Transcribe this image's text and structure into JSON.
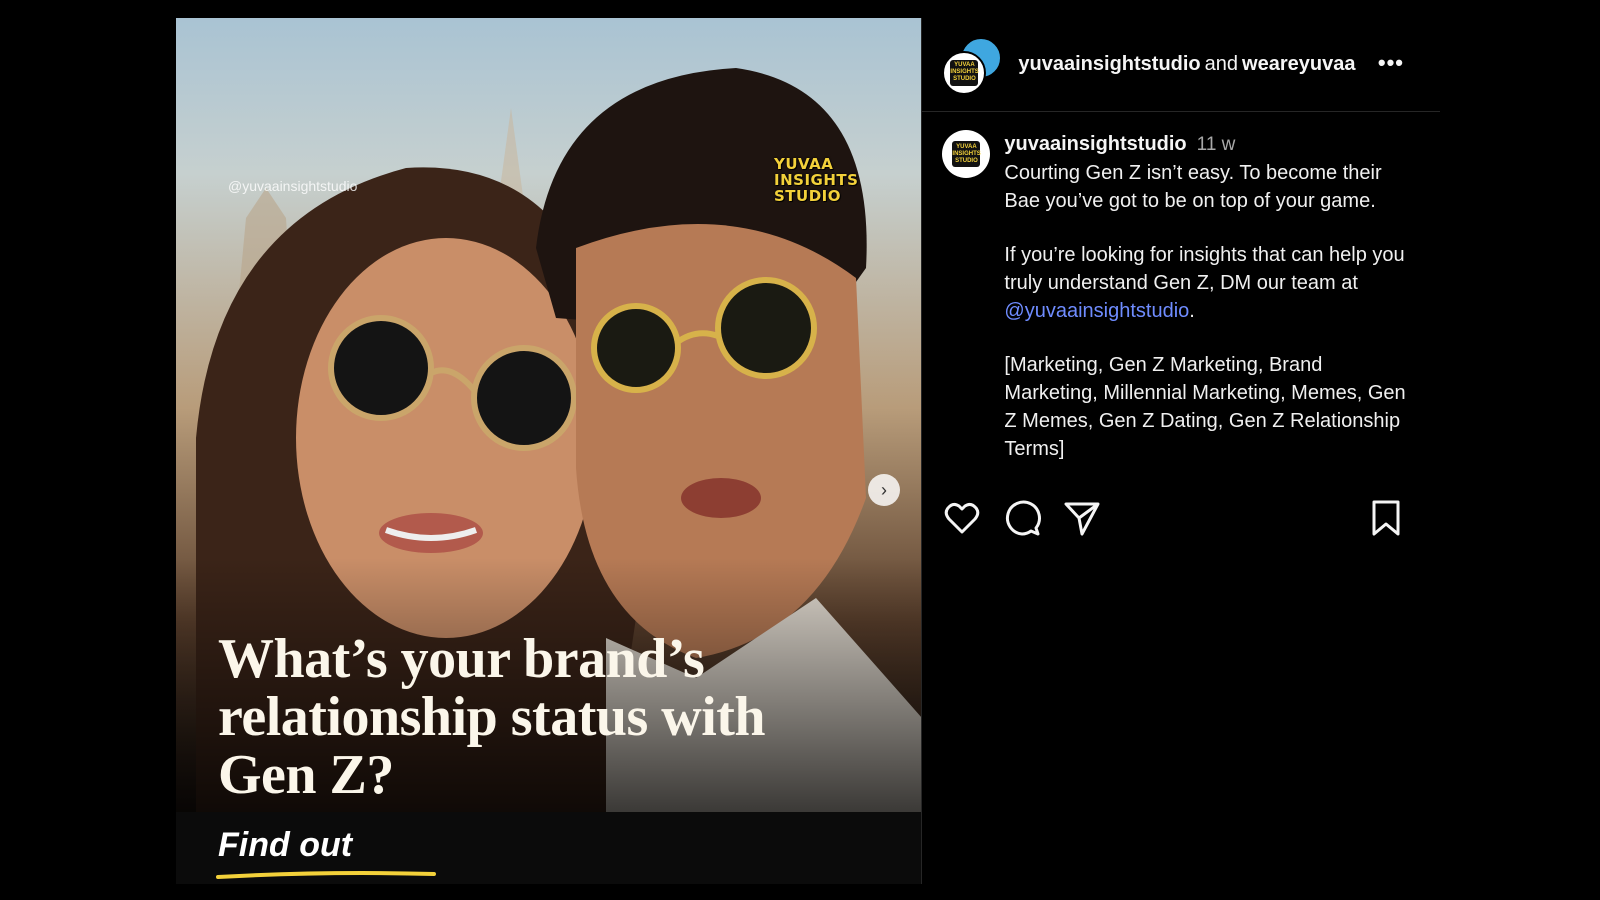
{
  "media": {
    "watermark": "@yuvaainsightstudio",
    "logo_lines": [
      "YUVAA",
      "INSIGHTS",
      "STUDIO"
    ],
    "headline_lines": [
      "What’s your brand’s",
      "relationship status with",
      "Gen Z?"
    ],
    "cta": "Find out",
    "next_icon": "chevron-right-icon",
    "accent_color": "#f3d13a"
  },
  "header": {
    "user1": "yuvaainsightstudio",
    "conj": "and",
    "user2": "weareyuvaa",
    "more_icon": "ellipsis-icon",
    "more_glyph": "•••"
  },
  "caption": {
    "username": "yuvaainsightstudio",
    "time": "11 w",
    "p1": "Courting Gen Z isn’t easy. To become their Bae you’ve got to be on top of your game.",
    "p2_before": "If you’re looking for insights that can help you truly understand Gen Z, DM our team at ",
    "p2_mention": "@yuvaainsightstudio",
    "p2_after": ".",
    "p3": "[Marketing, Gen Z Marketing, Brand Marketing, Millennial Marketing, Memes, Gen Z Memes, Gen Z Dating, Gen Z Relationship Terms]",
    "mention_color": "#6f8cff"
  },
  "actions": {
    "like_icon": "heart-icon",
    "comment_icon": "comment-icon",
    "share_icon": "send-icon",
    "save_icon": "bookmark-icon"
  }
}
